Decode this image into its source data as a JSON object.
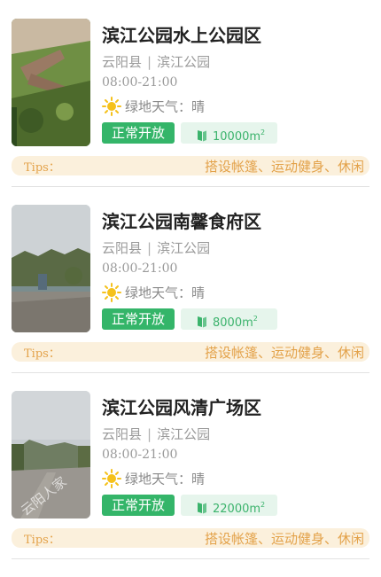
{
  "parks": [
    {
      "title": "滨江公园水上公园区",
      "county": "云阳县",
      "park": "滨江公园",
      "separator": "|",
      "hours": "08:00-21:00",
      "weather_label": "绿地天气：晴",
      "status": "正常开放",
      "area": "10000m",
      "area_unit_sup": "2",
      "tips_label": "Tips：",
      "tips_text": "搭设帐篷、运动健身、休闲"
    },
    {
      "title": "滨江公园南馨食府区",
      "county": "云阳县",
      "park": "滨江公园",
      "separator": "|",
      "hours": "08:00-21:00",
      "weather_label": "绿地天气：晴",
      "status": "正常开放",
      "area": "8000m",
      "area_unit_sup": "2",
      "tips_label": "Tips：",
      "tips_text": "搭设帐篷、运动健身、休闲"
    },
    {
      "title": "滨江公园风清广场区",
      "county": "云阳县",
      "park": "滨江公园",
      "separator": "|",
      "hours": "08:00-21:00",
      "weather_label": "绿地天气：晴",
      "status": "正常开放",
      "area": "22000m",
      "area_unit_sup": "2",
      "tips_label": "Tips：",
      "tips_text": "搭设帐篷、运动健身、休闲"
    }
  ],
  "icons": {
    "weather": "sun-icon",
    "area": "area-icon"
  },
  "colors": {
    "status_bg": "#34b569",
    "area_bg": "#e6f5ec",
    "tips_bg": "#fbf0dc",
    "tips_text": "#e3a24a"
  },
  "watermark": "云阳人家"
}
